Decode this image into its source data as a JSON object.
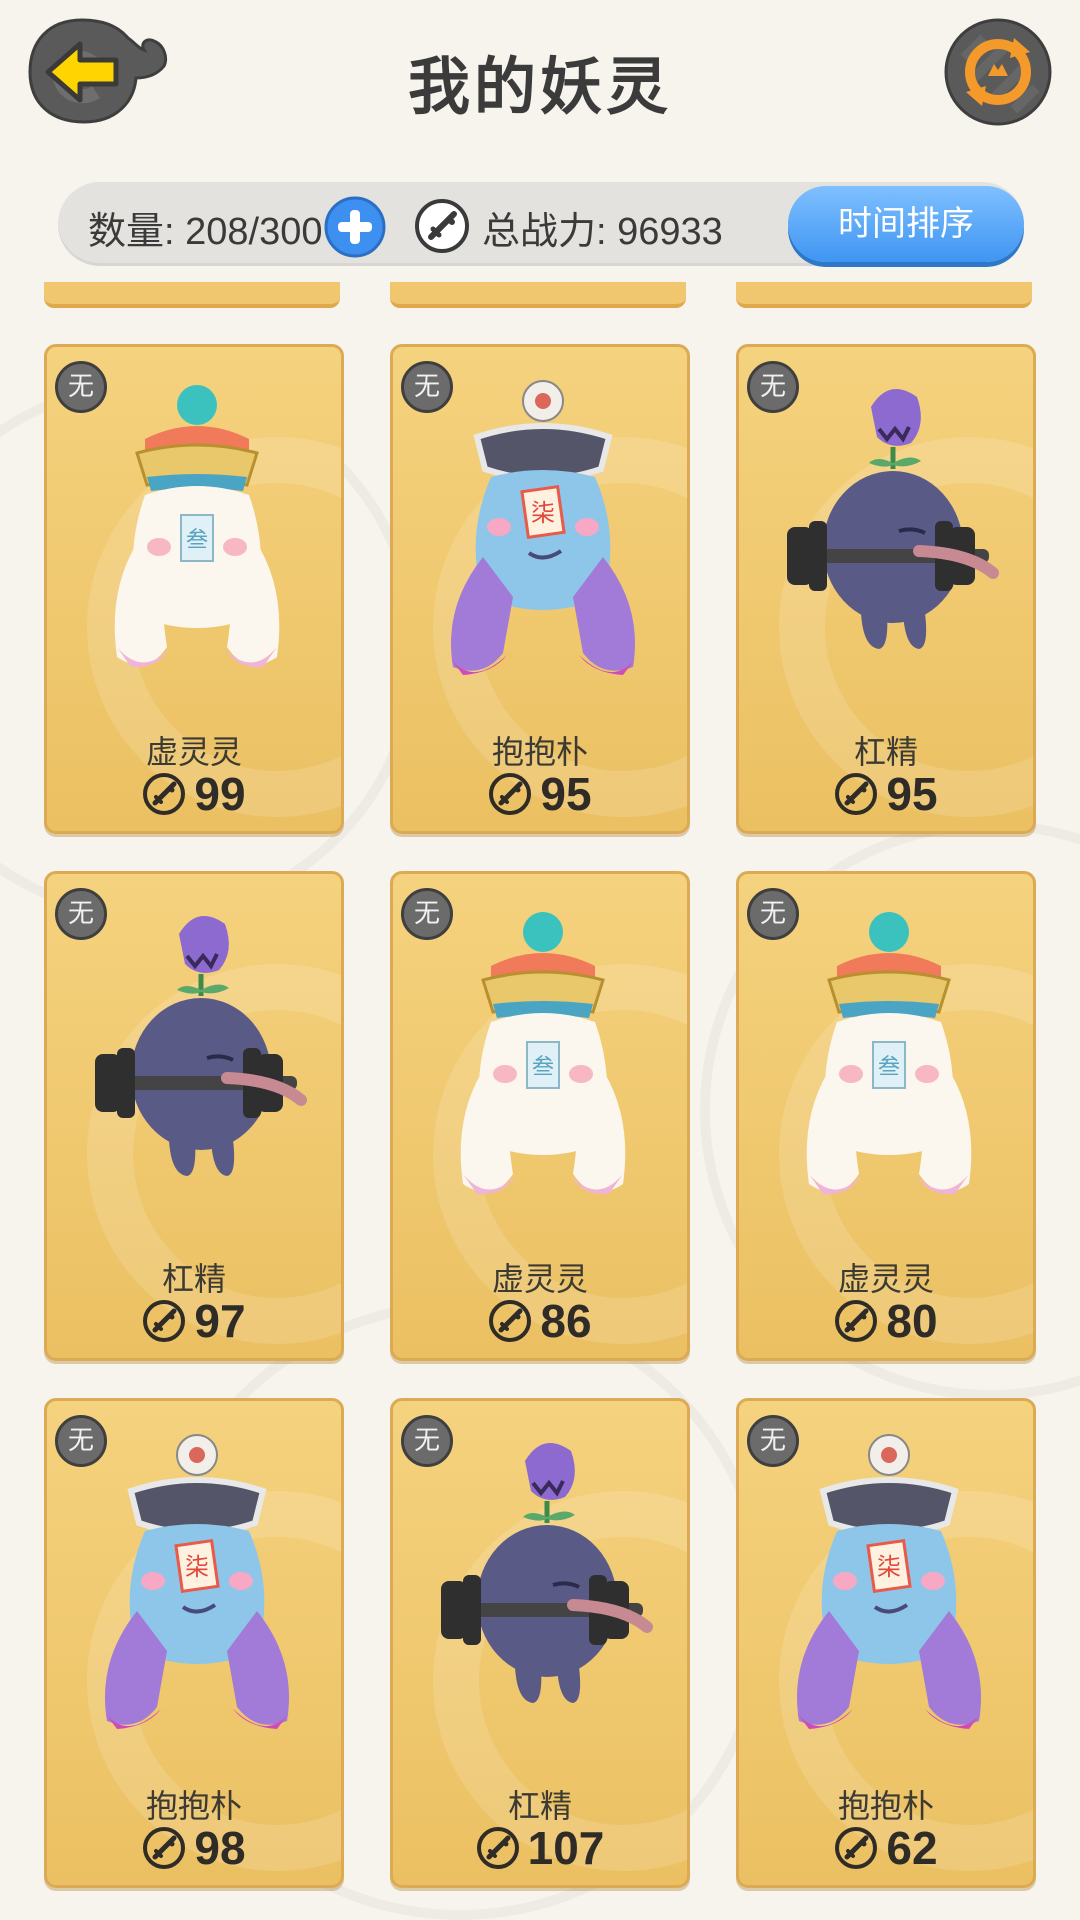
{
  "header": {
    "title": "我的妖灵",
    "back_icon": "back-arrow-icon",
    "refresh_icon": "refresh-swap-icon"
  },
  "stats": {
    "count_label": "数量: 208/300",
    "power_label": "总战力: 96933",
    "sort_button": "时间排序"
  },
  "colors": {
    "card_bg": "#f0c66f",
    "sort_button": "#4a9cf4",
    "back_yellow": "#ffd400"
  },
  "cards": [
    {
      "badge": "无",
      "name": "虚灵灵",
      "power": "99",
      "creature": "xulingling"
    },
    {
      "badge": "无",
      "name": "抱抱朴",
      "power": "95",
      "creature": "baobaopu"
    },
    {
      "badge": "无",
      "name": "杠精",
      "power": "95",
      "creature": "gangjing"
    },
    {
      "badge": "无",
      "name": "杠精",
      "power": "97",
      "creature": "gangjing"
    },
    {
      "badge": "无",
      "name": "虚灵灵",
      "power": "86",
      "creature": "xulingling"
    },
    {
      "badge": "无",
      "name": "虚灵灵",
      "power": "80",
      "creature": "xulingling"
    },
    {
      "badge": "无",
      "name": "抱抱朴",
      "power": "98",
      "creature": "baobaopu"
    },
    {
      "badge": "无",
      "name": "杠精",
      "power": "107",
      "creature": "gangjing"
    },
    {
      "badge": "无",
      "name": "抱抱朴",
      "power": "62",
      "creature": "baobaopu"
    }
  ]
}
